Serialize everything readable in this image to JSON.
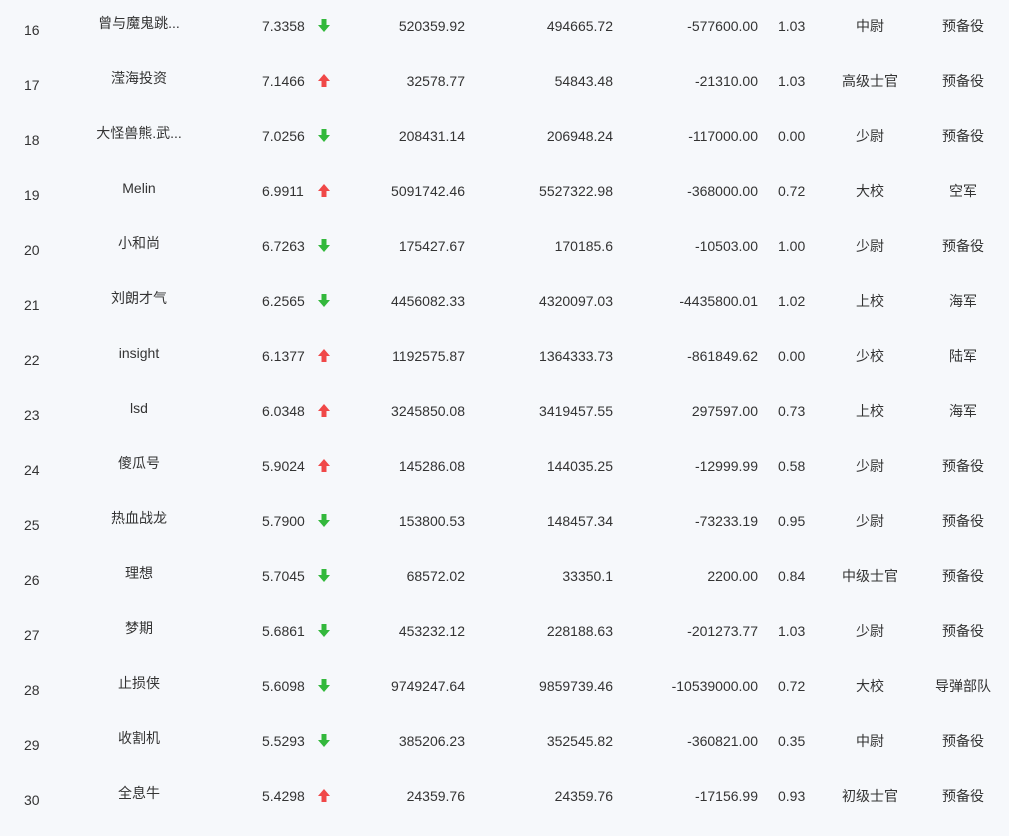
{
  "colors": {
    "up": "#f04848",
    "down": "#33b83c",
    "text": "#333333",
    "background": "#f6f8fb"
  },
  "rows": [
    {
      "rank": "16",
      "name": "曾与魔鬼跳...",
      "score": "7.3358",
      "trend": "down",
      "trend_icon": "arrow-down-icon",
      "v1": "520359.92",
      "v2": "494665.72",
      "v3": "-577600.00",
      "ratio": "1.03",
      "rank_name": "中尉",
      "branch": "预备役"
    },
    {
      "rank": "17",
      "name": "滢海投资",
      "score": "7.1466",
      "trend": "up",
      "trend_icon": "arrow-up-icon",
      "v1": "32578.77",
      "v2": "54843.48",
      "v3": "-21310.00",
      "ratio": "1.03",
      "rank_name": "高级士官",
      "branch": "预备役"
    },
    {
      "rank": "18",
      "name": "大怪兽熊.武...",
      "score": "7.0256",
      "trend": "down",
      "trend_icon": "arrow-down-icon",
      "v1": "208431.14",
      "v2": "206948.24",
      "v3": "-117000.00",
      "ratio": "0.00",
      "rank_name": "少尉",
      "branch": "预备役"
    },
    {
      "rank": "19",
      "name": "Melin",
      "score": "6.9911",
      "trend": "up",
      "trend_icon": "arrow-up-icon",
      "v1": "5091742.46",
      "v2": "5527322.98",
      "v3": "-368000.00",
      "ratio": "0.72",
      "rank_name": "大校",
      "branch": "空军"
    },
    {
      "rank": "20",
      "name": "小和尚",
      "score": "6.7263",
      "trend": "down",
      "trend_icon": "arrow-down-icon",
      "v1": "175427.67",
      "v2": "170185.6",
      "v3": "-10503.00",
      "ratio": "1.00",
      "rank_name": "少尉",
      "branch": "预备役"
    },
    {
      "rank": "21",
      "name": "刘朗才气",
      "score": "6.2565",
      "trend": "down",
      "trend_icon": "arrow-down-icon",
      "v1": "4456082.33",
      "v2": "4320097.03",
      "v3": "-4435800.01",
      "ratio": "1.02",
      "rank_name": "上校",
      "branch": "海军"
    },
    {
      "rank": "22",
      "name": "insight",
      "score": "6.1377",
      "trend": "up",
      "trend_icon": "arrow-up-icon",
      "v1": "1192575.87",
      "v2": "1364333.73",
      "v3": "-861849.62",
      "ratio": "0.00",
      "rank_name": "少校",
      "branch": "陆军"
    },
    {
      "rank": "23",
      "name": "lsd",
      "score": "6.0348",
      "trend": "up",
      "trend_icon": "arrow-up-icon",
      "v1": "3245850.08",
      "v2": "3419457.55",
      "v3": "297597.00",
      "ratio": "0.73",
      "rank_name": "上校",
      "branch": "海军"
    },
    {
      "rank": "24",
      "name": "傻瓜号",
      "score": "5.9024",
      "trend": "up",
      "trend_icon": "arrow-up-icon",
      "v1": "145286.08",
      "v2": "144035.25",
      "v3": "-12999.99",
      "ratio": "0.58",
      "rank_name": "少尉",
      "branch": "预备役"
    },
    {
      "rank": "25",
      "name": "热血战龙",
      "score": "5.7900",
      "trend": "down",
      "trend_icon": "arrow-down-icon",
      "v1": "153800.53",
      "v2": "148457.34",
      "v3": "-73233.19",
      "ratio": "0.95",
      "rank_name": "少尉",
      "branch": "预备役"
    },
    {
      "rank": "26",
      "name": "理想",
      "score": "5.7045",
      "trend": "down",
      "trend_icon": "arrow-down-icon",
      "v1": "68572.02",
      "v2": "33350.1",
      "v3": "2200.00",
      "ratio": "0.84",
      "rank_name": "中级士官",
      "branch": "预备役"
    },
    {
      "rank": "27",
      "name": "梦期",
      "score": "5.6861",
      "trend": "down",
      "trend_icon": "arrow-down-icon",
      "v1": "453232.12",
      "v2": "228188.63",
      "v3": "-201273.77",
      "ratio": "1.03",
      "rank_name": "少尉",
      "branch": "预备役"
    },
    {
      "rank": "28",
      "name": "止损侠",
      "score": "5.6098",
      "trend": "down",
      "trend_icon": "arrow-down-icon",
      "v1": "9749247.64",
      "v2": "9859739.46",
      "v3": "-10539000.00",
      "ratio": "0.72",
      "rank_name": "大校",
      "branch": "导弹部队"
    },
    {
      "rank": "29",
      "name": "收割机",
      "score": "5.5293",
      "trend": "down",
      "trend_icon": "arrow-down-icon",
      "v1": "385206.23",
      "v2": "352545.82",
      "v3": "-360821.00",
      "ratio": "0.35",
      "rank_name": "中尉",
      "branch": "预备役"
    },
    {
      "rank": "30",
      "name": "全息牛",
      "score": "5.4298",
      "trend": "up",
      "trend_icon": "arrow-up-icon",
      "v1": "24359.76",
      "v2": "24359.76",
      "v3": "-17156.99",
      "ratio": "0.93",
      "rank_name": "初级士官",
      "branch": "预备役"
    }
  ]
}
